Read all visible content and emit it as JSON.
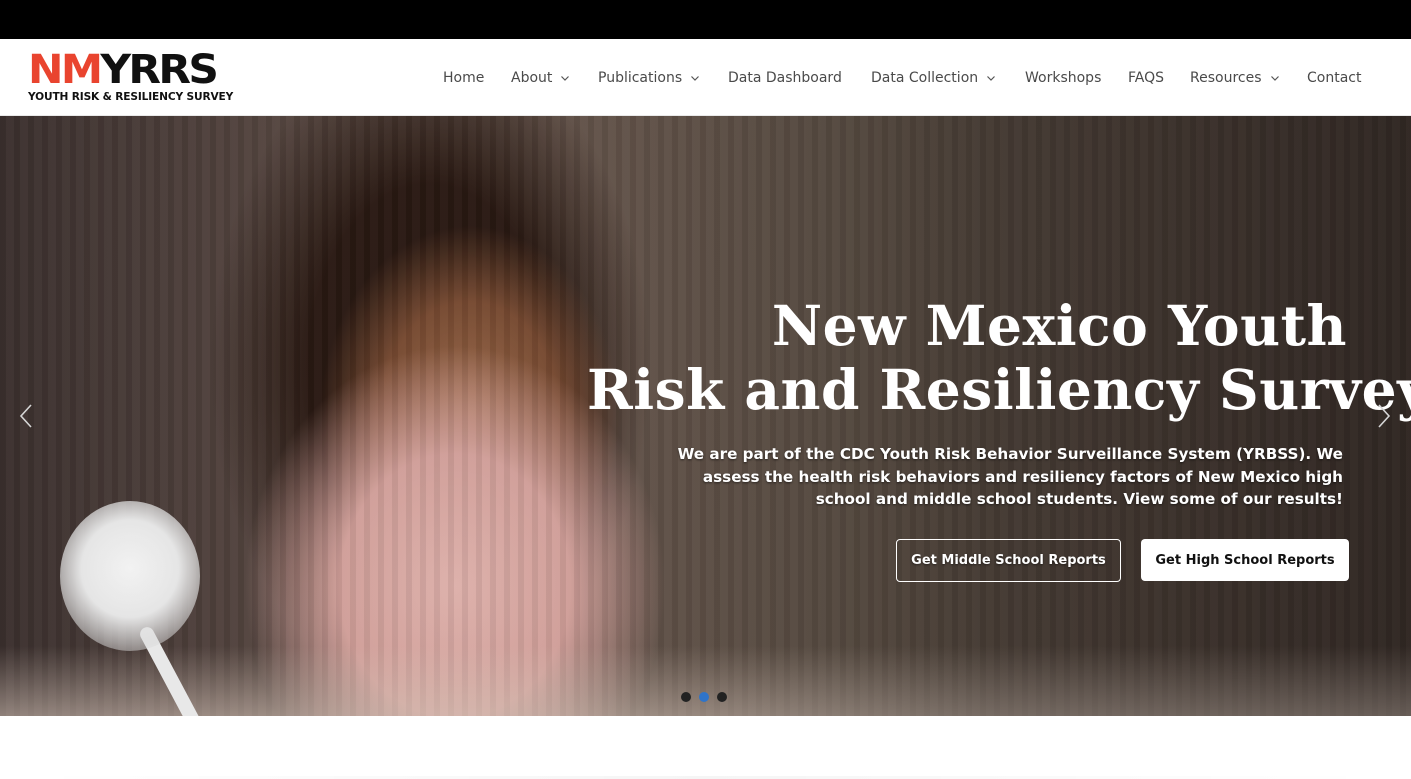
{
  "logo": {
    "big_nm": "NM",
    "big_rest": "YRRS",
    "subtitle": "YOUTH RISK & RESILIENCY SURVEY"
  },
  "nav": {
    "items": [
      {
        "label": "Home",
        "dropdown": false
      },
      {
        "label": "About",
        "dropdown": true
      },
      {
        "label": "Publications",
        "dropdown": true
      },
      {
        "label": "Data Dashboard",
        "dropdown": false
      },
      {
        "label": "Data Collection",
        "dropdown": true
      },
      {
        "label": "Workshops",
        "dropdown": false
      },
      {
        "label": "FAQS",
        "dropdown": false
      },
      {
        "label": "Resources",
        "dropdown": true
      },
      {
        "label": "Contact",
        "dropdown": false
      }
    ]
  },
  "hero": {
    "title_line1": "New Mexico Youth",
    "title_line2": "Risk and Resiliency Survey",
    "subtitle": "We are part of the CDC Youth Risk Behavior Surveillance System (YRBSS). We assess the health risk behaviors and resiliency factors of New Mexico high school and middle school students. View some of our results!",
    "btn_middle": "Get Middle School Reports",
    "btn_high": "Get High School Reports",
    "slides_total": 3,
    "active_slide": 2
  },
  "colors": {
    "brand_red": "#e9442f",
    "top_bar": "#000000",
    "nav_text": "#4a4a4a",
    "active_dot": "#2f74c9"
  },
  "icons": {
    "prev": "chevron-left-icon",
    "next": "chevron-right-icon",
    "dropdown": "chevron-down-icon"
  }
}
